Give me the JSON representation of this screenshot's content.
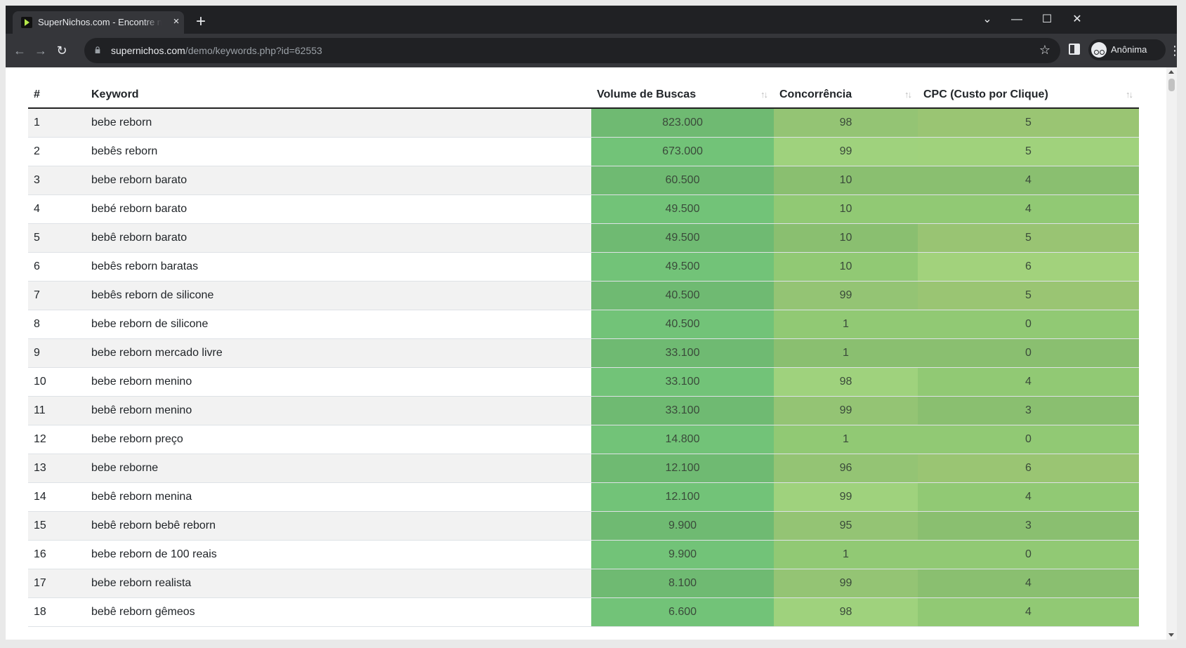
{
  "browser": {
    "tab_title": "SuperNichos.com - Encontre nichos",
    "tab_close": "×",
    "new_tab": "+",
    "url_host": "supernichos.com",
    "url_path": "/demo/keywords.php?id=62553",
    "profile_label": "Anônima",
    "icons": [
      "back-icon",
      "forward-icon",
      "reload-icon",
      "lock-icon",
      "star-icon",
      "side-panel-icon",
      "incognito-icon",
      "menu-icon"
    ],
    "window_controls": {
      "collapse": "⌄",
      "minimize": "—",
      "maximize": "☐",
      "close": "✕"
    },
    "nav": {
      "back": "←",
      "forward": "→",
      "reload": "↻",
      "star": "☆",
      "menu": "⋮"
    }
  },
  "table": {
    "headers": {
      "index": "#",
      "keyword": "Keyword",
      "volume": "Volume de Buscas",
      "competition": "Concorrência",
      "cpc": "CPC (Custo por Clique)"
    },
    "sort_icon": "↑↓",
    "rows": [
      {
        "n": "1",
        "keyword": "bebe reborn",
        "volume": "823.000",
        "competition": "98",
        "cpc": "5"
      },
      {
        "n": "2",
        "keyword": "bebês reborn",
        "volume": "673.000",
        "competition": "99",
        "cpc": "5"
      },
      {
        "n": "3",
        "keyword": "bebe reborn barato",
        "volume": "60.500",
        "competition": "10",
        "cpc": "4"
      },
      {
        "n": "4",
        "keyword": "bebé reborn barato",
        "volume": "49.500",
        "competition": "10",
        "cpc": "4"
      },
      {
        "n": "5",
        "keyword": "bebê reborn barato",
        "volume": "49.500",
        "competition": "10",
        "cpc": "5"
      },
      {
        "n": "6",
        "keyword": "bebês reborn baratas",
        "volume": "49.500",
        "competition": "10",
        "cpc": "6"
      },
      {
        "n": "7",
        "keyword": "bebês reborn de silicone",
        "volume": "40.500",
        "competition": "99",
        "cpc": "5"
      },
      {
        "n": "8",
        "keyword": "bebe reborn de silicone",
        "volume": "40.500",
        "competition": "1",
        "cpc": "0"
      },
      {
        "n": "9",
        "keyword": "bebe reborn mercado livre",
        "volume": "33.100",
        "competition": "1",
        "cpc": "0"
      },
      {
        "n": "10",
        "keyword": "bebe reborn menino",
        "volume": "33.100",
        "competition": "98",
        "cpc": "4"
      },
      {
        "n": "11",
        "keyword": "bebê reborn menino",
        "volume": "33.100",
        "competition": "99",
        "cpc": "3"
      },
      {
        "n": "12",
        "keyword": "bebe reborn preço",
        "volume": "14.800",
        "competition": "1",
        "cpc": "0"
      },
      {
        "n": "13",
        "keyword": "bebe reborne",
        "volume": "12.100",
        "competition": "96",
        "cpc": "6"
      },
      {
        "n": "14",
        "keyword": "bebê reborn menina",
        "volume": "12.100",
        "competition": "99",
        "cpc": "4"
      },
      {
        "n": "15",
        "keyword": "bebê reborn bebê reborn",
        "volume": "9.900",
        "competition": "95",
        "cpc": "3"
      },
      {
        "n": "16",
        "keyword": "bebe reborn de 100 reais",
        "volume": "9.900",
        "competition": "1",
        "cpc": "0"
      },
      {
        "n": "17",
        "keyword": "bebe reborn realista",
        "volume": "8.100",
        "competition": "99",
        "cpc": "4"
      },
      {
        "n": "18",
        "keyword": "bebê reborn gêmeos",
        "volume": "6.600",
        "competition": "98",
        "cpc": "4"
      }
    ]
  },
  "cell_colors": {
    "volume": [
      "#6fba72",
      "#72c378",
      "#6fba72",
      "#72c378",
      "#6fba72",
      "#72c378",
      "#6fba72",
      "#72c378",
      "#6fba72",
      "#72c378",
      "#6fba72",
      "#72c378",
      "#6fba72",
      "#72c378",
      "#6fba72",
      "#72c378",
      "#6fba72",
      "#72c378"
    ],
    "competition": [
      "#94c474",
      "#9fd27d",
      "#8abf70",
      "#91c974",
      "#8abf70",
      "#91c974",
      "#94c474",
      "#91c974",
      "#8abf70",
      "#9fd27d",
      "#94c474",
      "#91c974",
      "#94c474",
      "#9fd27d",
      "#94c474",
      "#91c974",
      "#94c474",
      "#9fd27d"
    ],
    "cpc": [
      "#9ac573",
      "#a0d27c",
      "#8abf70",
      "#91c974",
      "#99c473",
      "#a2d27c",
      "#9ac573",
      "#91c974",
      "#8abf70",
      "#91c974",
      "#8abf70",
      "#91c974",
      "#9ac573",
      "#91c974",
      "#8abf70",
      "#91c974",
      "#8abf70",
      "#91c974"
    ]
  }
}
